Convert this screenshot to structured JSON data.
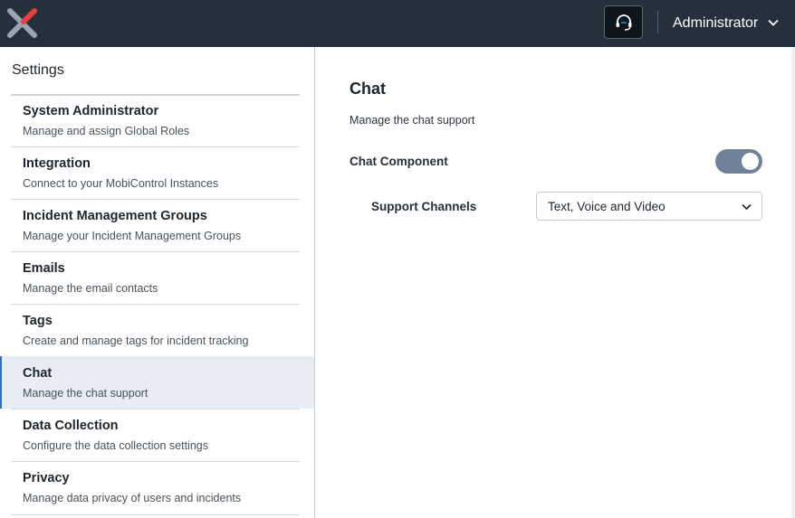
{
  "header": {
    "user_name": "Administrator",
    "support_icon": "headset-icon",
    "menu_icon": "chevron-down-icon",
    "colors": {
      "background": "#26303d",
      "logo_red": "#e8413c",
      "logo_grey": "#9aa5b4",
      "support_dot": "#3db1f5"
    }
  },
  "sidebar": {
    "title": "Settings",
    "items": [
      {
        "title": "System Administrator",
        "description": "Manage and assign Global Roles",
        "active": false
      },
      {
        "title": "Integration",
        "description": "Connect to your MobiControl Instances",
        "active": false
      },
      {
        "title": "Incident Management Groups",
        "description": "Manage your Incident Management Groups",
        "active": false
      },
      {
        "title": "Emails",
        "description": "Manage the email contacts",
        "active": false
      },
      {
        "title": "Tags",
        "description": "Create and manage tags for incident tracking",
        "active": false
      },
      {
        "title": "Chat",
        "description": "Manage the chat support",
        "active": true
      },
      {
        "title": "Data Collection",
        "description": "Configure the data collection settings",
        "active": false
      },
      {
        "title": "Privacy",
        "description": "Manage data privacy of users and incidents",
        "active": false
      }
    ]
  },
  "content": {
    "title": "Chat",
    "subtitle": "Manage the chat support",
    "chat_component": {
      "label": "Chat Component",
      "enabled": true,
      "toggle_color": "#6f8297"
    },
    "support_channels": {
      "label": "Support Channels",
      "selected": "Text, Voice and Video",
      "icon": "chevron-down-icon"
    }
  }
}
